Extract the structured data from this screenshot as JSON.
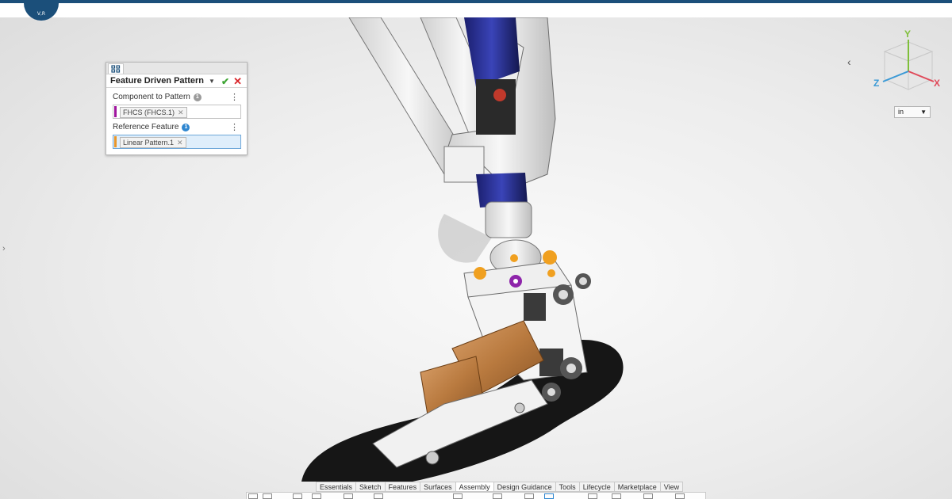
{
  "header": {
    "logo_text": "V,R"
  },
  "panel": {
    "title": "Feature Driven Pattern",
    "component_label": "Component to Pattern",
    "component_count": "1",
    "component_value": "FHCS (FHCS.1)",
    "reference_label": "Reference Feature",
    "reference_count": "1",
    "reference_value": "Linear Pattern.1"
  },
  "viewcube": {
    "x": "X",
    "y": "Y",
    "z": "Z"
  },
  "units": {
    "value": "in"
  },
  "ribbon": {
    "tabs": [
      "Essentials",
      "Sketch",
      "Features",
      "Surfaces",
      "Assembly",
      "Design Guidance",
      "Tools",
      "Lifecycle",
      "Marketplace",
      "View"
    ],
    "active_tab": "Assembly"
  },
  "colors": {
    "brand": "#1b4f7a",
    "ok": "#3fa535",
    "cancel": "#d9262b",
    "component_bar": "#a0169e",
    "reference_bar": "#e8962c",
    "badge_blue": "#2e86d0",
    "badge_grey": "#9b9b9b"
  },
  "icons": {
    "panel_tab": "pattern-icon",
    "ok": "checkmark-icon",
    "cancel": "close-icon"
  }
}
